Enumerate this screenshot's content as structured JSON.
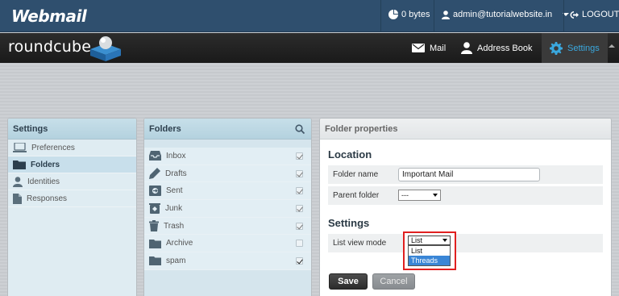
{
  "topbar": {
    "brand": "Webmail",
    "quota": "0 bytes",
    "user": "admin@tutorialwebsite.in",
    "logout": "LOGOUT"
  },
  "navbar": {
    "logo": "roundcube",
    "items": [
      {
        "label": "Mail",
        "icon": "envelope-icon"
      },
      {
        "label": "Address Book",
        "icon": "person-icon"
      },
      {
        "label": "Settings",
        "icon": "gear-icon",
        "active": true
      }
    ]
  },
  "settings_panel": {
    "title": "Settings",
    "items": [
      {
        "label": "Preferences",
        "icon": "monitor-icon"
      },
      {
        "label": "Folders",
        "icon": "folder-icon",
        "selected": true
      },
      {
        "label": "Identities",
        "icon": "person-icon"
      },
      {
        "label": "Responses",
        "icon": "document-icon"
      }
    ]
  },
  "folders_panel": {
    "title": "Folders",
    "items": [
      {
        "label": "Inbox",
        "icon": "inbox-icon",
        "subscribed": true
      },
      {
        "label": "Drafts",
        "icon": "pencil-icon",
        "subscribed": true
      },
      {
        "label": "Sent",
        "icon": "sent-icon",
        "subscribed": true
      },
      {
        "label": "Junk",
        "icon": "junk-icon",
        "subscribed": true
      },
      {
        "label": "Trash",
        "icon": "trash-icon",
        "subscribed": true
      },
      {
        "label": "Archive",
        "icon": "folder-icon",
        "subscribed": false
      },
      {
        "label": "spam",
        "icon": "folder-icon",
        "subscribed": true
      }
    ]
  },
  "properties": {
    "title": "Folder properties",
    "location_heading": "Location",
    "folder_name_label": "Folder name",
    "folder_name_value": "Important Mail",
    "parent_folder_label": "Parent folder",
    "parent_folder_value": "---",
    "settings_heading": "Settings",
    "list_view_label": "List view mode",
    "list_view_value": "List",
    "list_view_options": [
      "List",
      "Threads"
    ],
    "save": "Save",
    "cancel": "Cancel"
  },
  "colors": {
    "topbar": "#2f4f6e",
    "accent": "#3aa8de",
    "highlight_border": "#e02020"
  }
}
